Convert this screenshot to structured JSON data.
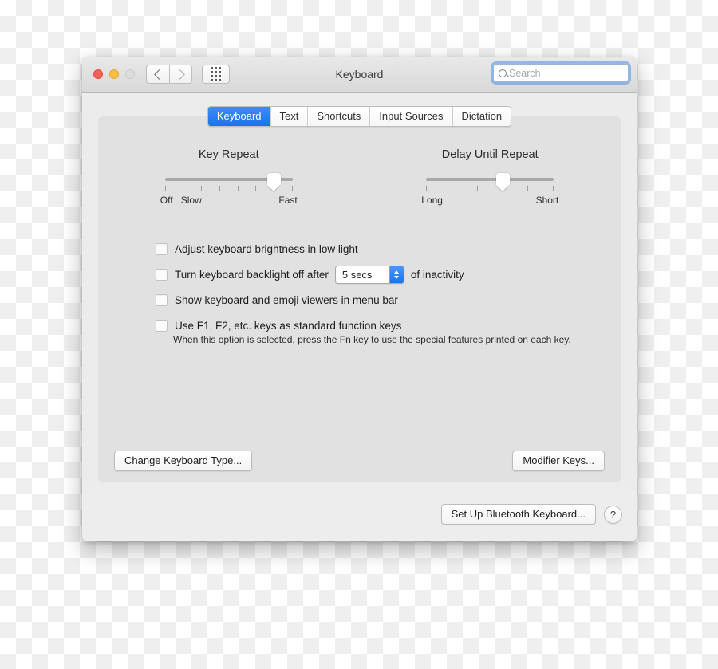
{
  "window": {
    "title": "Keyboard",
    "traffic_lights": [
      "close",
      "minimize",
      "zoom"
    ],
    "nav": {
      "back_icon": "chevron-left-icon",
      "forward_icon": "chevron-right-icon",
      "show_all_icon": "grid-icon"
    },
    "search": {
      "placeholder": "Search",
      "value": "",
      "icon": "search-icon"
    }
  },
  "tabs": [
    {
      "label": "Keyboard",
      "active": true
    },
    {
      "label": "Text",
      "active": false
    },
    {
      "label": "Shortcuts",
      "active": false
    },
    {
      "label": "Input Sources",
      "active": false
    },
    {
      "label": "Dictation",
      "active": false
    }
  ],
  "sliders": [
    {
      "title": "Key Repeat",
      "left_label": "Off",
      "second_label": "Slow",
      "right_label": "Fast",
      "ticks": 8,
      "value_index": 6
    },
    {
      "title": "Delay Until Repeat",
      "left_label": "Long",
      "second_label": "",
      "right_label": "Short",
      "ticks": 6,
      "value_index": 3
    }
  ],
  "options": [
    {
      "label": "Adjust keyboard brightness in low light",
      "checked": false
    },
    {
      "label": "Turn keyboard backlight off after",
      "label_after": "of inactivity",
      "checked": false,
      "stepper": {
        "value": "5 secs",
        "up_icon": "chevron-up-icon",
        "down_icon": "chevron-down-icon"
      }
    },
    {
      "label": "Show keyboard and emoji viewers in menu bar",
      "checked": false
    },
    {
      "label": "Use F1, F2, etc. keys as standard function keys",
      "checked": false,
      "description": "When this option is selected, press the Fn key to use the special features printed on each key."
    }
  ],
  "panel_buttons": {
    "change_keyboard_type": "Change Keyboard Type...",
    "modifier_keys": "Modifier Keys..."
  },
  "bottom_bar": {
    "bluetooth_setup": "Set Up Bluetooth Keyboard...",
    "help": "?"
  },
  "colors": {
    "accent": "#1a72ef",
    "window_bg": "#ececec",
    "panel_bg": "#e1e1e1",
    "bottom_bg": "#ededed",
    "close": "#fc6058",
    "minimize": "#fec041",
    "zoom_disabled": "#dcdcdc"
  }
}
